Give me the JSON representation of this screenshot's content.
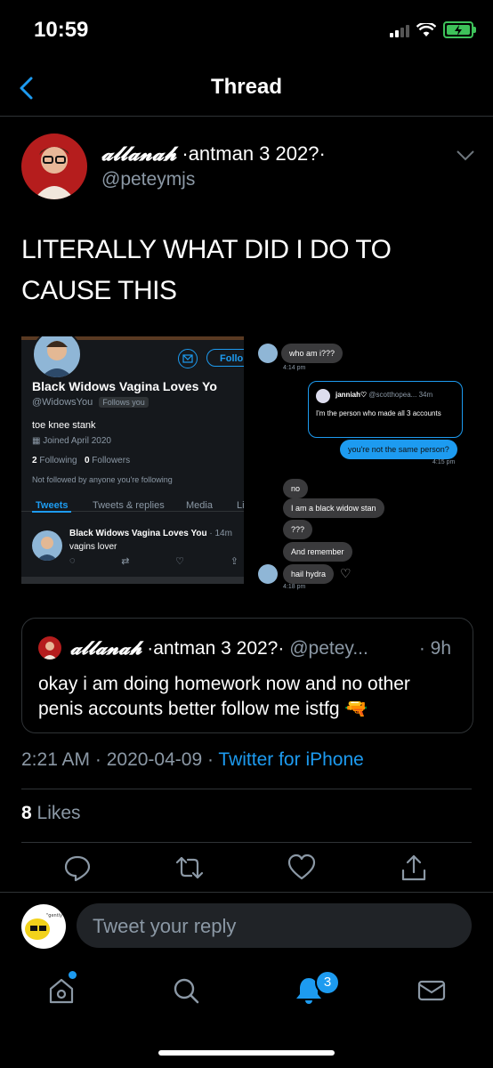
{
  "status": {
    "time": "10:59"
  },
  "nav": {
    "title": "Thread"
  },
  "tweet": {
    "author_name_styled": "𝓪𝓵𝓵𝓪𝓷𝓪𝓱",
    "author_name_rest": " ·antman 3 202?·",
    "handle": "@peteymjs",
    "text": "LITERALLY WHAT DID I DO TO CAUSE THIS",
    "timestamp": "2:21 AM · 2020-04-09 · ",
    "source": "Twitter for iPhone",
    "likes_count": "8",
    "likes_label": " Likes"
  },
  "media_left": {
    "follow_label": "Follo",
    "profile_name": "Black Widows Vagina Loves Yo",
    "profile_handle": "@WidowsYou",
    "follows_you": "Follows you",
    "bio": "toe knee stank",
    "joined": "Joined April 2020",
    "following_count": "2",
    "following_label": "Following",
    "followers_count": "0",
    "followers_label": "Followers",
    "not_followed": "Not followed by anyone you're following",
    "tabs": [
      "Tweets",
      "Tweets & replies",
      "Media",
      "Li"
    ],
    "mini_tweet_name": "Black Widows Vagina Loves You",
    "mini_tweet_time": "· 14m",
    "mini_tweet_text": "vagins lover"
  },
  "media_right": {
    "msg1": "who am i???",
    "msg1_time": "4:14 pm",
    "quoted_name": "janniah♡",
    "quoted_handle": "@scotthopea...",
    "quoted_time": "34m",
    "quoted_text": "I'm the person who made all 3 accounts",
    "msg2": "you're not the same person?",
    "msg2_time": "4:15 pm",
    "msgs": [
      "no",
      "I am a black widow stan",
      "???",
      "And remember",
      "hail hydra"
    ],
    "last_time": "4:18 pm"
  },
  "quote": {
    "author_name_styled": "𝓪𝓵𝓵𝓪𝓷𝓪𝓱",
    "author_name_rest": " ·antman 3 202?·",
    "handle": "@petey...",
    "time": "· 9h",
    "text": "okay i am doing homework now and no other penis accounts better follow me istfg 🔫"
  },
  "reply": {
    "placeholder": "Tweet your reply"
  },
  "tabbar": {
    "notifications_badge": "3"
  },
  "colors": {
    "accent": "#1d9bf0",
    "background": "#000000",
    "muted": "#8b98a5"
  }
}
